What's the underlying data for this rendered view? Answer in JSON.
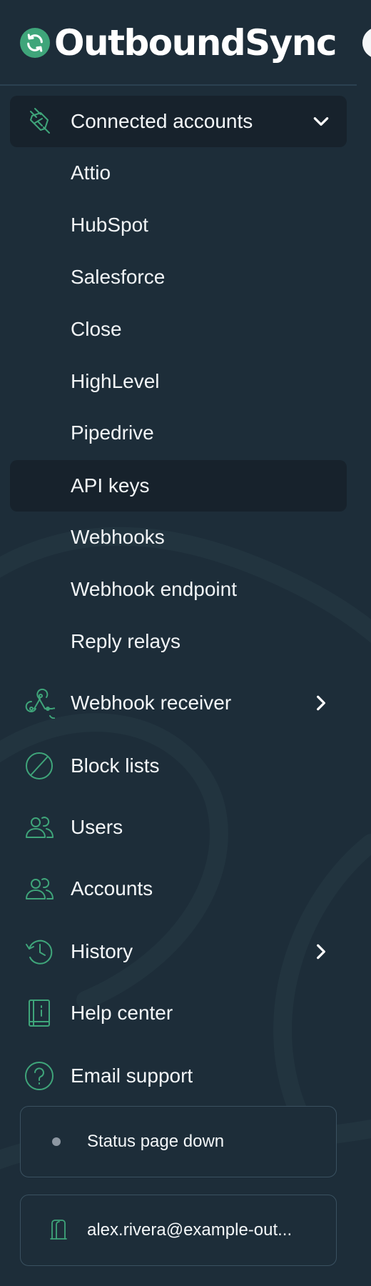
{
  "brand": {
    "name": "OutboundSync"
  },
  "colors": {
    "accent": "#3fa57a",
    "background": "#1d2d39",
    "active_row": "#17222c"
  },
  "nav": {
    "connected_accounts": {
      "label": "Connected accounts",
      "icon": "plug-icon",
      "expanded": true
    },
    "sub_items": [
      {
        "label": "Attio"
      },
      {
        "label": "HubSpot"
      },
      {
        "label": "Salesforce"
      },
      {
        "label": "Close"
      },
      {
        "label": "HighLevel"
      },
      {
        "label": "Pipedrive"
      },
      {
        "label": "API keys",
        "active": true
      },
      {
        "label": "Webhooks"
      },
      {
        "label": "Webhook endpoint"
      },
      {
        "label": "Reply relays"
      }
    ],
    "webhook_receiver": {
      "label": "Webhook receiver",
      "icon": "webhook-icon"
    },
    "block_lists": {
      "label": "Block lists",
      "icon": "block-icon"
    },
    "users": {
      "label": "Users",
      "icon": "users-icon"
    },
    "accounts": {
      "label": "Accounts",
      "icon": "accounts-icon"
    },
    "history": {
      "label": "History",
      "icon": "history-icon"
    },
    "help_center": {
      "label": "Help center",
      "icon": "book-icon"
    },
    "email_support": {
      "label": "Email support",
      "icon": "help-circle-icon"
    }
  },
  "status_card": {
    "text": "Status page down"
  },
  "user_card": {
    "email": "alex.rivera@example-out..."
  }
}
